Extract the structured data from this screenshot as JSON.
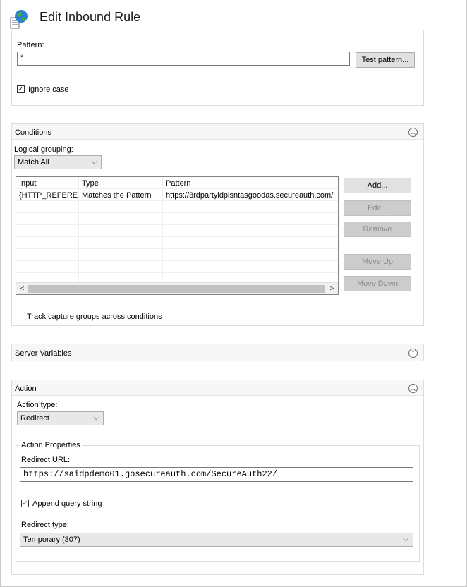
{
  "page": {
    "title": "Edit Inbound Rule"
  },
  "match": {
    "pattern_label": "Pattern:",
    "pattern_value": "*",
    "test_pattern_button": "Test pattern...",
    "ignore_case_label": "Ignore case",
    "ignore_case_checked": true
  },
  "conditions": {
    "title": "Conditions",
    "logical_grouping_label": "Logical grouping:",
    "logical_grouping_value": "Match All",
    "columns": [
      "Input",
      "Type",
      "Pattern"
    ],
    "rows": [
      {
        "input": "{HTTP_REFERER}",
        "type": "Matches the Pattern",
        "pattern": "https://3rdpartyidpisntasgoodas.secureauth.com/"
      }
    ],
    "buttons": {
      "add": "Add...",
      "edit": "Edit...",
      "remove": "Remove",
      "move_up": "Move Up",
      "move_down": "Move Down"
    },
    "track_capture_label": "Track capture groups across conditions",
    "track_capture_checked": false
  },
  "server_variables": {
    "title": "Server Variables"
  },
  "action": {
    "title": "Action",
    "action_type_label": "Action type:",
    "action_type_value": "Redirect",
    "properties_title": "Action Properties",
    "redirect_url_label": "Redirect URL:",
    "redirect_url_value": "https://saidpdemo01.gosecureauth.com/SecureAuth22/",
    "append_query_label": "Append query string",
    "append_query_checked": true,
    "redirect_type_label": "Redirect type:",
    "redirect_type_value": "Temporary (307)"
  },
  "icons": {
    "collapse": "chevron-up-circle-icon",
    "expand": "chevron-down-circle-icon",
    "dropdown": "chevron-down-icon",
    "check": "checkmark-icon"
  }
}
